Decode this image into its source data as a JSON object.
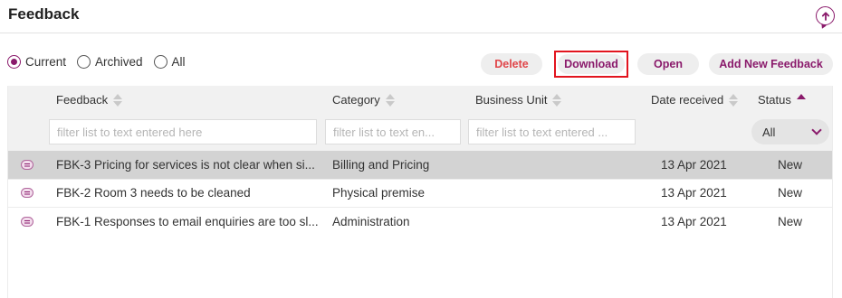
{
  "header": {
    "title": "Feedback",
    "upload_icon": "upload-arrow-icon"
  },
  "filters": {
    "scope_options": [
      {
        "label": "Current",
        "checked": true
      },
      {
        "label": "Archived",
        "checked": false
      },
      {
        "label": "All",
        "checked": false
      }
    ]
  },
  "toolbar": {
    "delete_label": "Delete",
    "download_label": "Download",
    "open_label": "Open",
    "add_label": "Add New Feedback"
  },
  "table": {
    "columns": [
      {
        "label": "Feedback",
        "filter_placeholder": "filter list to text entered here"
      },
      {
        "label": "Category",
        "filter_placeholder": "filter list to text en..."
      },
      {
        "label": "Business Unit",
        "filter_placeholder": "filter list to text entered ..."
      },
      {
        "label": "Date received"
      },
      {
        "label": "Status",
        "filter_value": "All"
      }
    ],
    "rows": [
      {
        "feedback": "FBK-3 Pricing for services is not clear when si...",
        "category": "Billing and Pricing",
        "business_unit": "",
        "date": "13 Apr 2021",
        "status": "New",
        "selected": true
      },
      {
        "feedback": "FBK-2 Room 3 needs to be cleaned",
        "category": "Physical premise",
        "business_unit": "",
        "date": "13 Apr 2021",
        "status": "New",
        "selected": false
      },
      {
        "feedback": "FBK-1 Responses to email enquiries are too sl...",
        "category": "Administration",
        "business_unit": "",
        "date": "13 Apr 2021",
        "status": "New",
        "selected": false
      }
    ]
  },
  "colors": {
    "accent": "#8a1a6b",
    "delete": "#e0464a",
    "highlight_border": "#e2141e",
    "selected_row": "#d3d3d3"
  }
}
